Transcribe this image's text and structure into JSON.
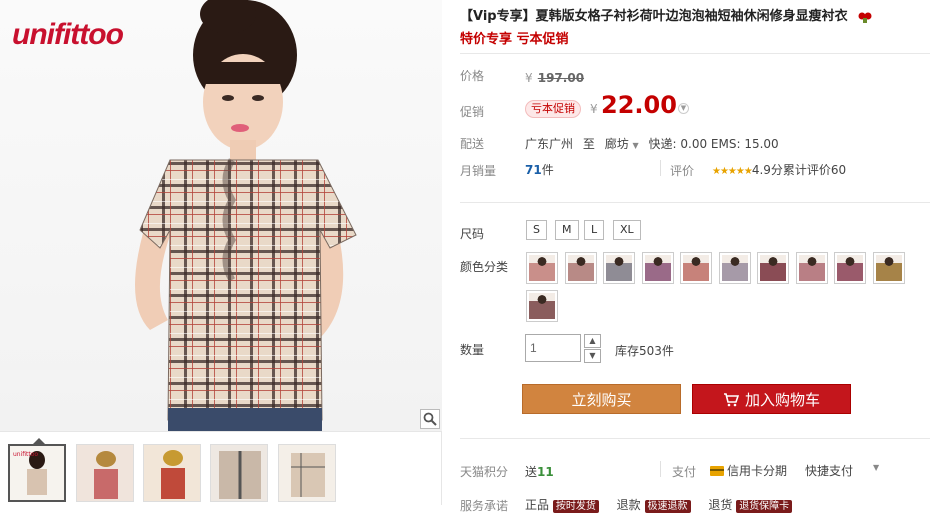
{
  "brand": {
    "logo_text": "unifittoo"
  },
  "gallery": {
    "zoom_icon": "magnifier-icon",
    "thumbnails": [
      "thumb-1",
      "thumb-2",
      "thumb-3",
      "thumb-4",
      "thumb-5"
    ]
  },
  "product": {
    "title": "【Vip专享】夏韩版女格子衬衫荷叶边泡泡袖短袖休闲修身显瘦衬衣",
    "subtitle": "特价专享 亏本促销",
    "price_label": "价格",
    "yen": "¥",
    "original_price": "197.00",
    "promo_label": "促销",
    "promo_tag": "亏本促销",
    "promo_yen": "¥",
    "promo_price": "22.00",
    "ship_label": "配送",
    "ship_from": "广东广州",
    "ship_to_word": "至",
    "ship_dest": "廊坊",
    "ship_fees": "快递: 0.00 EMS: 15.00",
    "sales_label": "月销量",
    "sales_count": "71",
    "sales_unit": "件",
    "rating_label": "评价",
    "rating_stars": "★★★★★",
    "rating_score": "4.9分",
    "rating_total": "累计评价60",
    "size_label": "尺码",
    "sizes": [
      "S",
      "M",
      "L",
      "XL"
    ],
    "color_label": "颜色分类",
    "qty_label": "数量",
    "qty_value": "1",
    "stock": "库存503件",
    "buy_now": "立刻购买",
    "add_cart": "加入购物车",
    "points_label": "天猫积分",
    "points_prefix": "送",
    "points_value": "11",
    "pay_label": "支付",
    "pay_credit": "信用卡分期",
    "pay_fast": "快捷支付",
    "service_label": "服务承诺",
    "service_items": [
      "正品",
      "按时发货",
      "退款",
      "极速退款",
      "退货",
      "退货保障卡"
    ]
  },
  "colors": {
    "accent_red": "#c40000",
    "buy_orange": "#d1843f",
    "cart_red": "#c4161c",
    "swatches": [
      "#c98f8a",
      "#b88a86",
      "#8f8c95",
      "#9a6a88",
      "#c7827a",
      "#a69aa8",
      "#8a4c55",
      "#b97f85",
      "#9a5a6b",
      "#a68348",
      "#8a5d5d"
    ]
  }
}
